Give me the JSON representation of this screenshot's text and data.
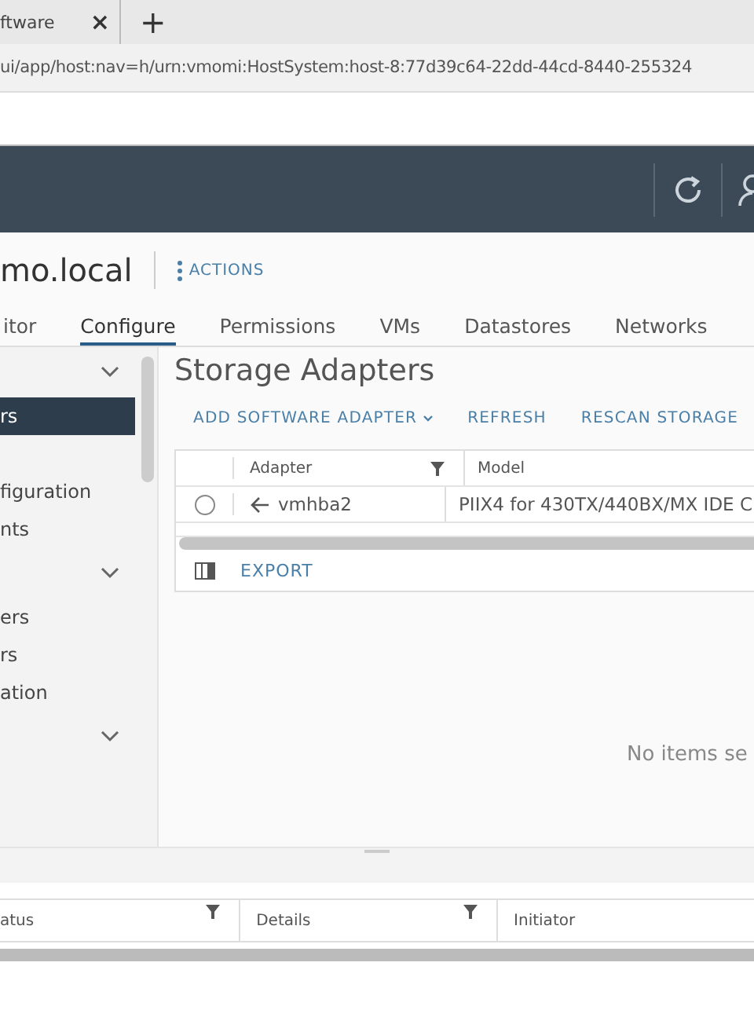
{
  "browser": {
    "tab": {
      "title": "ftware",
      "close": "×"
    },
    "new_tab": "+",
    "url": "ui/app/host:nav=h/urn:vmomi:HostSystem:host-8:77d39c64-22dd-44cd-8440-255324"
  },
  "object": {
    "title": "mo.local",
    "actions": "ACTIONS"
  },
  "tabs": [
    {
      "label": "itor",
      "selected": false
    },
    {
      "label": "Configure",
      "selected": true
    },
    {
      "label": "Permissions",
      "selected": false
    },
    {
      "label": "VMs",
      "selected": false
    },
    {
      "label": "Datastores",
      "selected": false
    },
    {
      "label": "Networks",
      "selected": false
    }
  ],
  "sidebar": {
    "items": [
      {
        "kind": "group"
      },
      {
        "kind": "item",
        "label": "rs",
        "selected": true
      },
      {
        "kind": "item",
        "selected": false
      },
      {
        "kind": "item",
        "label": "figuration",
        "selected": false
      },
      {
        "kind": "item",
        "label": "nts",
        "selected": false
      },
      {
        "kind": "group"
      },
      {
        "kind": "item",
        "label": "ers",
        "selected": false
      },
      {
        "kind": "item",
        "label": "rs",
        "selected": false
      },
      {
        "kind": "item",
        "label": "ation",
        "selected": false
      },
      {
        "kind": "group"
      }
    ]
  },
  "main": {
    "title": "Storage Adapters",
    "toolbar": [
      "ADD SOFTWARE ADAPTER",
      "REFRESH",
      "RESCAN STORAGE"
    ],
    "table": {
      "columns": [
        "Adapter",
        "Model"
      ],
      "rows": [
        {
          "selected": false,
          "adapter": "vmhba2",
          "model": "PIIX4 for 430TX/440BX/MX IDE C"
        }
      ]
    },
    "export": "EXPORT",
    "empty": "No items se"
  },
  "bottom_table": {
    "columns": [
      {
        "label": "atus",
        "filter": true
      },
      {
        "label": "Details",
        "filter": true
      },
      {
        "label": "Initiator",
        "filter": false
      }
    ]
  }
}
